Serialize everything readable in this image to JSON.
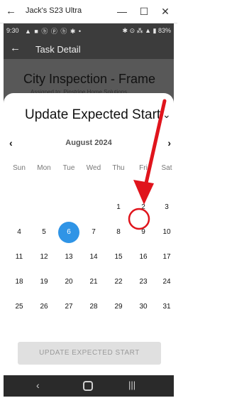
{
  "window": {
    "title": "Jack's S23 Ultra",
    "back_icon": "←",
    "minimize_icon": "—",
    "maximize_icon": "☐",
    "close_icon": "✕"
  },
  "status_bar": {
    "time": "9:30",
    "notification_icons": "▲ ■ ⓑ ⓟ ⓑ ✱ •",
    "right": "✱ ⊙ ⁂ ▲ ▮ 83%"
  },
  "app_bar": {
    "title": "Task Detail",
    "back_icon": "←"
  },
  "background": {
    "job_title": "City Inspection - Frame",
    "subtitle": "Assigned to: Pinstripe Home Solutions"
  },
  "sheet": {
    "title": "Update Expected Start",
    "chevron": "⌄",
    "month_label": "August 2024",
    "prev": "‹",
    "next": "›",
    "weekdays": [
      "Sun",
      "Mon",
      "Tue",
      "Wed",
      "Thu",
      "Fri",
      "Sat"
    ],
    "days": [
      {
        "n": "1",
        "col": 4,
        "row": 0
      },
      {
        "n": "2",
        "col": 5,
        "row": 0
      },
      {
        "n": "3",
        "col": 6,
        "row": 0
      },
      {
        "n": "4",
        "col": 0,
        "row": 1
      },
      {
        "n": "5",
        "col": 1,
        "row": 1
      },
      {
        "n": "6",
        "col": 2,
        "row": 1,
        "selected": true
      },
      {
        "n": "7",
        "col": 3,
        "row": 1
      },
      {
        "n": "8",
        "col": 4,
        "row": 1
      },
      {
        "n": "9",
        "col": 5,
        "row": 1,
        "circled": true
      },
      {
        "n": "10",
        "col": 6,
        "row": 1
      },
      {
        "n": "11",
        "col": 0,
        "row": 2
      },
      {
        "n": "12",
        "col": 1,
        "row": 2
      },
      {
        "n": "13",
        "col": 2,
        "row": 2
      },
      {
        "n": "14",
        "col": 3,
        "row": 2
      },
      {
        "n": "15",
        "col": 4,
        "row": 2
      },
      {
        "n": "16",
        "col": 5,
        "row": 2
      },
      {
        "n": "17",
        "col": 6,
        "row": 2
      },
      {
        "n": "18",
        "col": 0,
        "row": 3
      },
      {
        "n": "19",
        "col": 1,
        "row": 3
      },
      {
        "n": "20",
        "col": 2,
        "row": 3
      },
      {
        "n": "21",
        "col": 3,
        "row": 3
      },
      {
        "n": "22",
        "col": 4,
        "row": 3
      },
      {
        "n": "23",
        "col": 5,
        "row": 3
      },
      {
        "n": "24",
        "col": 6,
        "row": 3
      },
      {
        "n": "25",
        "col": 0,
        "row": 4
      },
      {
        "n": "26",
        "col": 1,
        "row": 4
      },
      {
        "n": "27",
        "col": 2,
        "row": 4
      },
      {
        "n": "28",
        "col": 3,
        "row": 4
      },
      {
        "n": "29",
        "col": 4,
        "row": 4
      },
      {
        "n": "30",
        "col": 5,
        "row": 4
      },
      {
        "n": "31",
        "col": 6,
        "row": 4
      }
    ],
    "button_label": "UPDATE EXPECTED START"
  },
  "nav_bar": {
    "back_icon": "‹",
    "recent_icon": "|||"
  },
  "colors": {
    "selected_day": "#2f94e6",
    "annotation": "#e0141c"
  }
}
